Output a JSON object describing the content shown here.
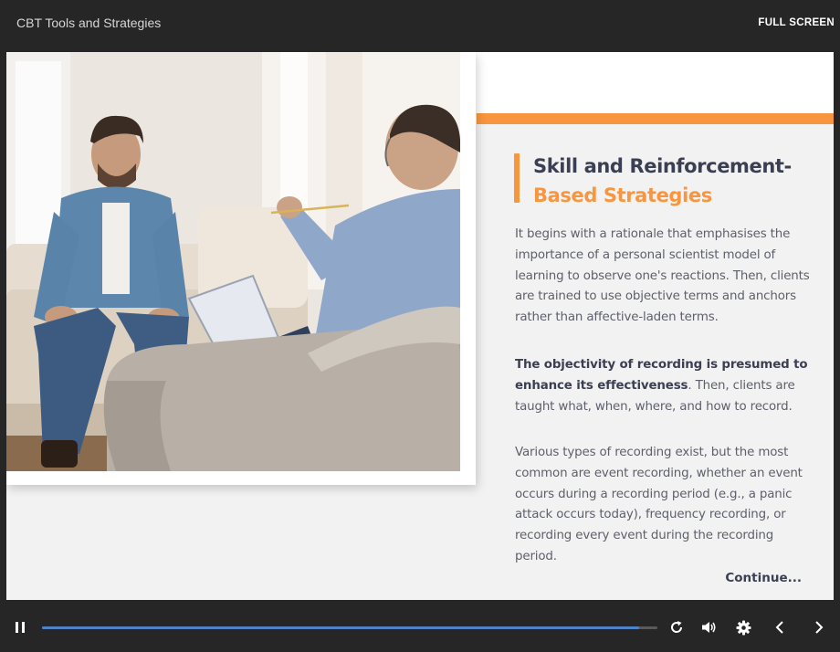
{
  "header": {
    "course_title": "CBT Tools and Strategies",
    "fullscreen_label": "FULL SCREEN"
  },
  "slide": {
    "heading_line1": "Skill and Reinforcement-",
    "heading_line2": "Based Strategies",
    "paragraph1": "It begins with a rationale that emphasises the importance of a personal scientist model of learning to observe one's reactions. Then, clients are trained to use objective terms and anchors rather than affective-laden terms.",
    "paragraph2_bold": "The objectivity of recording is presumed to enhance its effectiveness",
    "paragraph2_rest": ". Then, clients are taught what, when, where, and how to record.",
    "paragraph3": "Various types of recording exist, but the most common are event recording, whether an event occurs during a recording period (e.g., a panic attack occurs today), frequency recording, or recording every event during the recording period.",
    "continue_label": "Continue..."
  },
  "player": {
    "progress_fraction": 0.97,
    "icons": [
      "pause-icon",
      "replay-icon",
      "volume-icon",
      "settings-icon",
      "chevron-left-icon",
      "chevron-right-icon"
    ]
  },
  "colors": {
    "accent": "#f7963f",
    "heading": "#3b3f52",
    "body_text": "#5d5f6b",
    "progress": "#4f82c7",
    "chrome": "#262626"
  }
}
